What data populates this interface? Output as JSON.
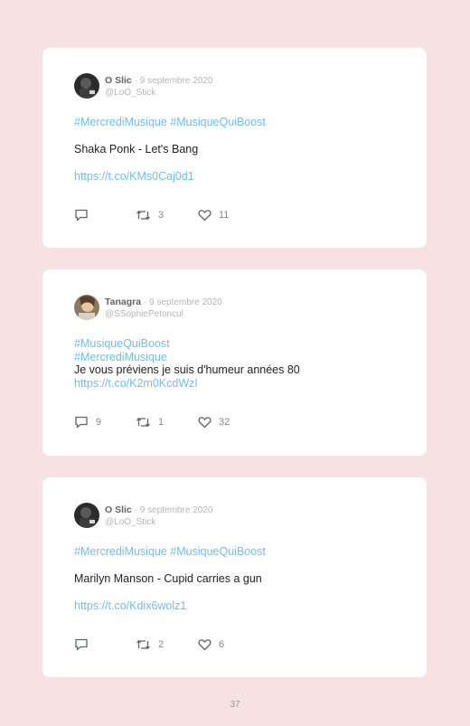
{
  "tweets": [
    {
      "name": "O Slic",
      "date": "· 9 septembre 2020",
      "handle": "@LoO_Stick",
      "hashtags": "#MercrediMusique #MusiqueQuiBoost",
      "text": "Shaka Ponk - Let's Bang",
      "link": "https://t.co/KMs0Caj0d1",
      "replies": "",
      "retweets": "3",
      "likes": "11"
    },
    {
      "name": "Tanagra",
      "date": "· 9 septembre 2020",
      "handle": "@SSophiePetoncul",
      "hashtag1": "#MusiqueQuiBoost",
      "hashtag2": "#MercrediMusique",
      "text": "Je vous préviens je suis d'humeur années 80",
      "link": "https://t.co/K2m0KcdWzI",
      "replies": "9",
      "retweets": "1",
      "likes": "32"
    },
    {
      "name": "O Slic",
      "date": "· 9 septembre 2020",
      "handle": "@LoO_Stick",
      "hashtags": "#MercrediMusique #MusiqueQuiBoost",
      "text": "Marilyn Manson - Cupid carries a gun",
      "link": "https://t.co/Kdix6wolz1",
      "replies": "",
      "retweets": "2",
      "likes": "6"
    }
  ],
  "page_number": "37",
  "colors": {
    "background": "#f6e3e1",
    "card": "#ffffff",
    "link": "#6fc0e8",
    "muted": "#b6b6b6"
  }
}
